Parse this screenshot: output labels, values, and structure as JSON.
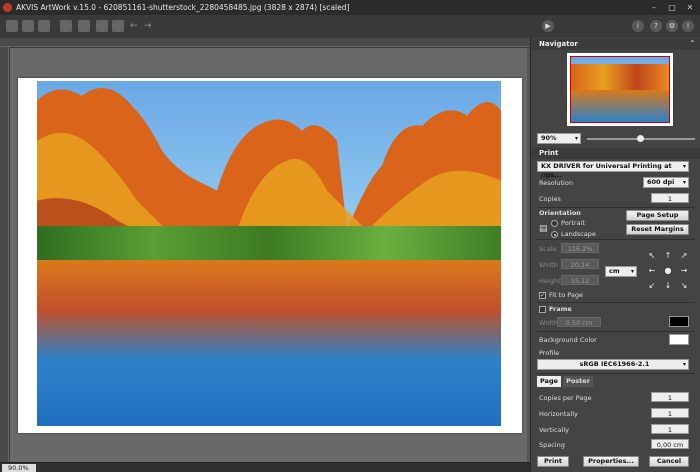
{
  "window": {
    "title": "AKVIS ArtWork v.15.0 - 620851161-shutterstock_2280458485.jpg (3828 x 2874) [scaled]",
    "minimize": "–",
    "maximize": "□",
    "close": "✕"
  },
  "status": {
    "zoom": "90.0%"
  },
  "navigator": {
    "title": "Navigator",
    "zoom": "90%"
  },
  "print": {
    "title": "Print",
    "printer": "KX DRIVER for Universal Printing at //ps...",
    "resolution_label": "Resolution",
    "resolution": "600 dpi",
    "copies_label": "Copies",
    "copies": "1",
    "orientation_label": "Orientation",
    "portrait": "Portrait",
    "landscape": "Landscape",
    "page_setup": "Page Setup",
    "reset_margins": "Reset Margins",
    "scale_label": "Scale",
    "scale": "116,2%",
    "width_label": "Width",
    "width": "20,14",
    "height_label": "Height",
    "height": "15,12",
    "unit": "cm",
    "fit_to_page": "Fit to Page",
    "frame": "Frame",
    "frame_width_label": "Width",
    "frame_width": "0,50 cm",
    "bg_color_label": "Background Color",
    "profile_label": "Profile",
    "profile": "sRGB IEC61966-2.1",
    "tabs": [
      "Page",
      "Poster"
    ],
    "copies_per_page_label": "Copies per Page",
    "copies_per_page": "1",
    "horizontally_label": "Horizontally",
    "horizontally": "1",
    "vertically_label": "Vertically",
    "vertically": "1",
    "spacing_label": "Spacing",
    "spacing": "0,00 cm",
    "print_btn": "Print",
    "properties_btn": "Properties...",
    "cancel_btn": "Cancel"
  },
  "colors": {
    "accent": "#c0392b",
    "frame_color": "#000000",
    "background_color": "#ffffff"
  }
}
